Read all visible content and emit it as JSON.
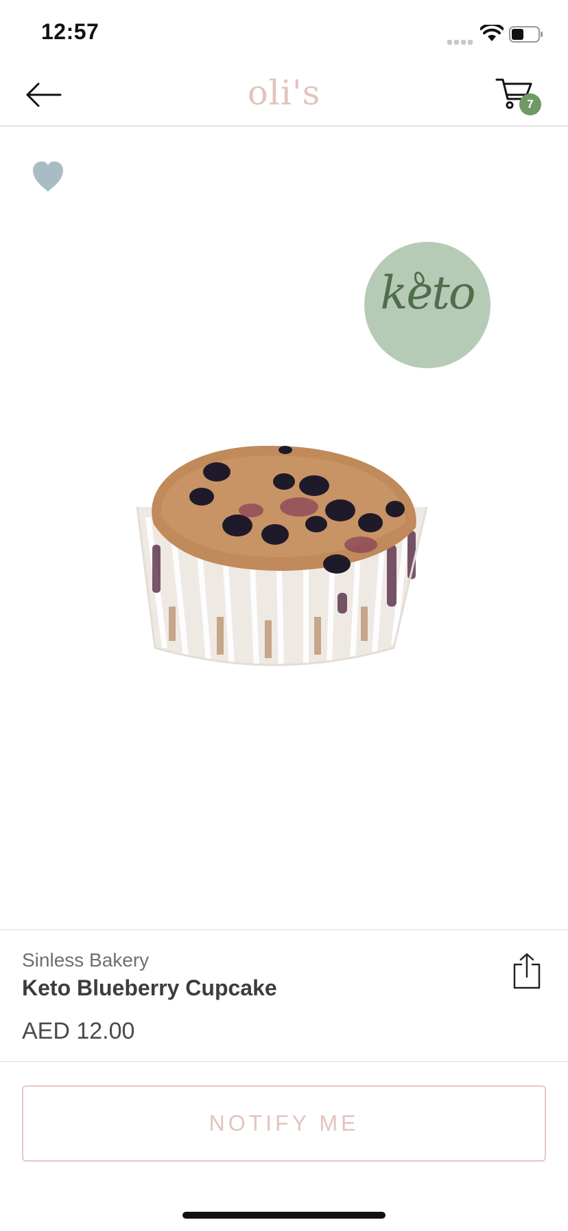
{
  "status_bar": {
    "time": "12:57"
  },
  "nav": {
    "brand": "oli's",
    "cart_count": "7"
  },
  "product": {
    "badge_label": "keto",
    "vendor": "Sinless Bakery",
    "name": "Keto Blueberry Cupcake",
    "price": "AED 12.00"
  },
  "actions": {
    "notify_label": "NOTIFY ME"
  },
  "colors": {
    "brand_pink": "#e2c4bd",
    "badge_green": "#6f9a64",
    "keto_bg": "#b6cbb5",
    "heart": "#a9bcc5"
  },
  "icons": {
    "back": "arrow-left-icon",
    "cart": "cart-icon",
    "favorite": "heart-icon",
    "share": "share-icon"
  }
}
